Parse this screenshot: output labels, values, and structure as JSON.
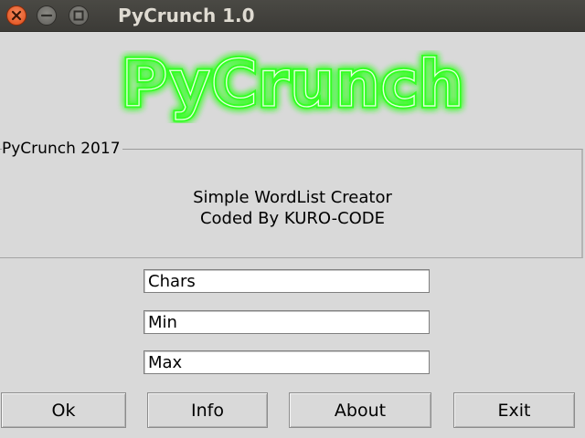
{
  "window": {
    "title": "PyCrunch 1.0",
    "buttons": [
      "close",
      "minimize",
      "maximize"
    ]
  },
  "logo": {
    "text": "PyCrunch",
    "color": "#39ff14"
  },
  "group": {
    "legend": "PyCrunch 2017",
    "line1": "Simple WordList Creator",
    "line2": "Coded By KURO-CODE"
  },
  "inputs": {
    "chars": "Chars",
    "min": "Min",
    "max": "Max"
  },
  "buttons": {
    "ok": "Ok",
    "info": "Info",
    "about": "About",
    "exit": "Exit"
  },
  "colors": {
    "titlebar": "#3c3b37",
    "close_button": "#df4a16",
    "window_bg": "#d9d9d9"
  }
}
